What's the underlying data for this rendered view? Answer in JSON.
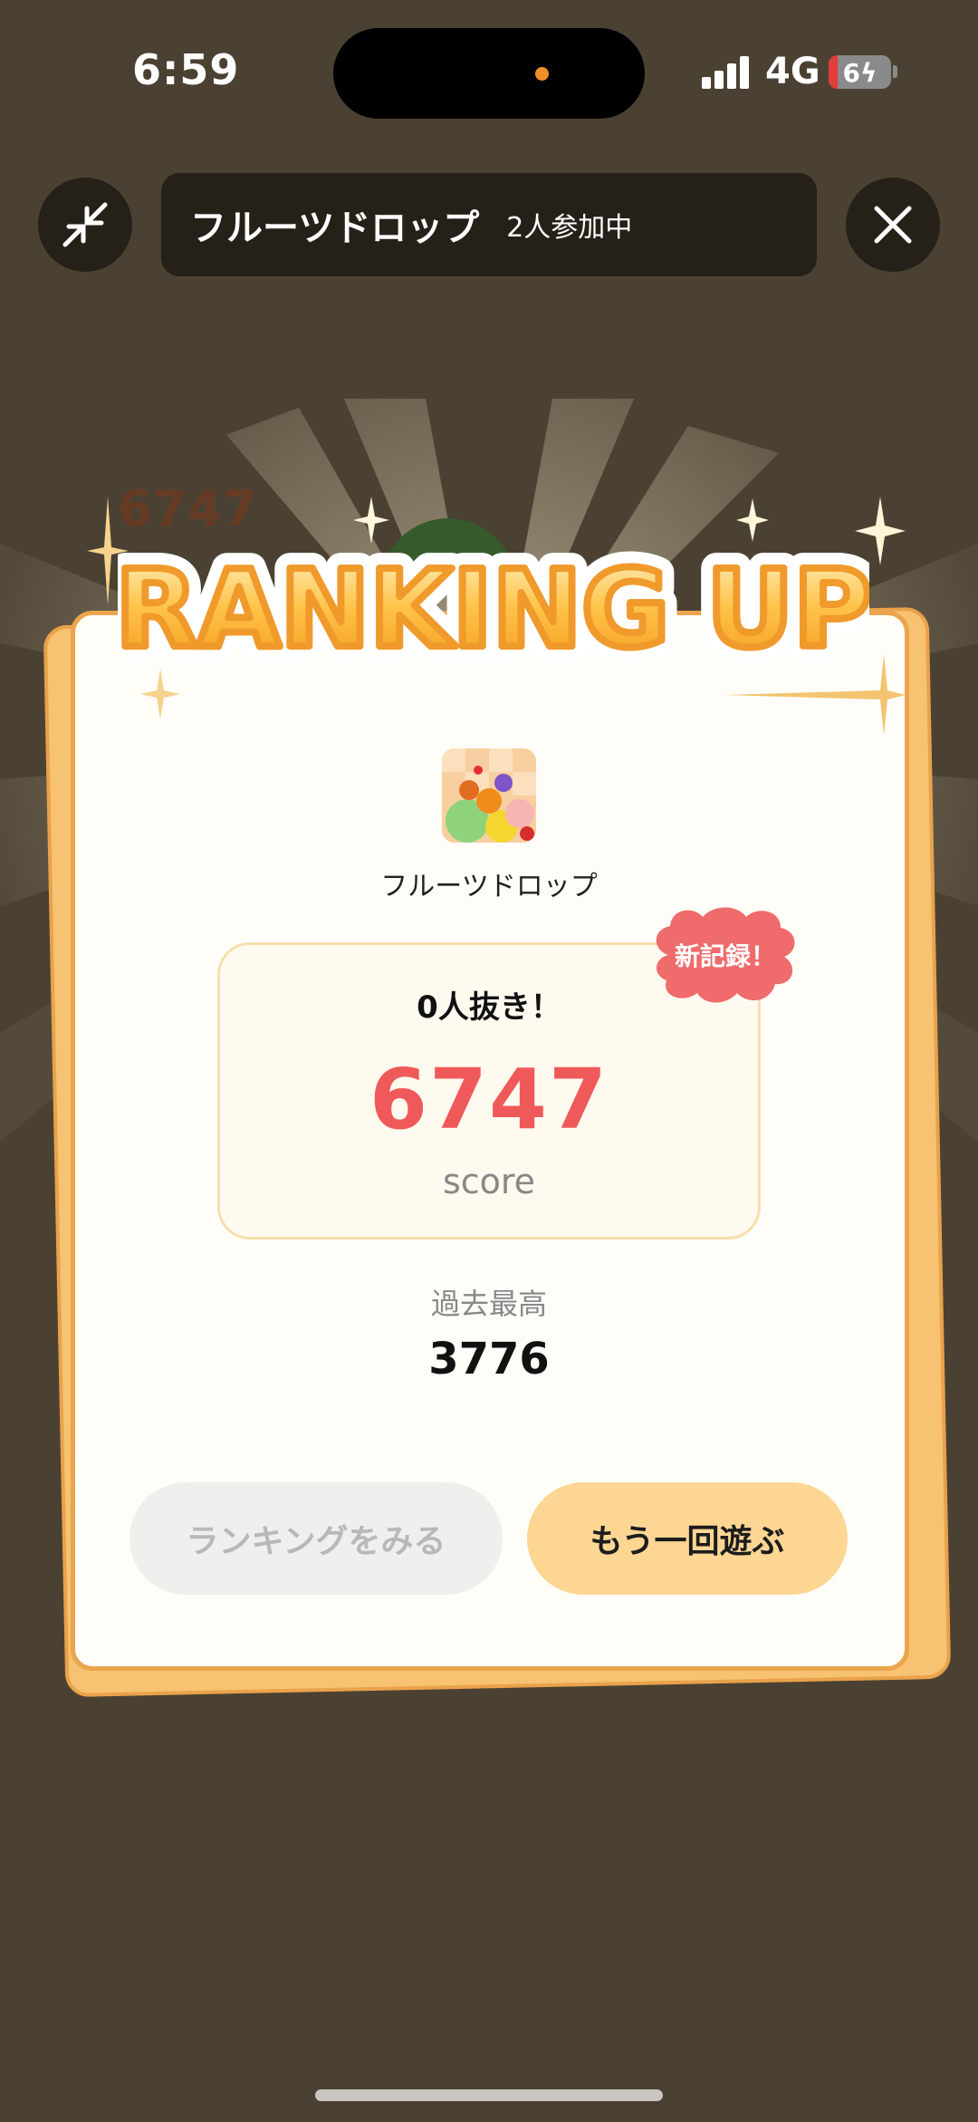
{
  "status_bar": {
    "time": "6:59",
    "network": "4G",
    "battery": "6"
  },
  "header": {
    "title": "フルーツドロップ",
    "participants": "2人参加中"
  },
  "banner": {
    "text": "RANKING UP",
    "ghost_score": "6747"
  },
  "card": {
    "app_name": "フルーツドロップ",
    "passed_text": "0人抜き！",
    "score": "6747",
    "score_label": "score",
    "badge": "新記録！",
    "best_label": "過去最高",
    "best_value": "3776"
  },
  "buttons": {
    "ranking": "ランキングをみる",
    "replay": "もう一回遊ぶ"
  },
  "colors": {
    "background": "#4b4133",
    "card_border": "#eaa54d",
    "score": "#f0595a",
    "badge": "#f06b6b",
    "replay_button": "#fdd694"
  }
}
